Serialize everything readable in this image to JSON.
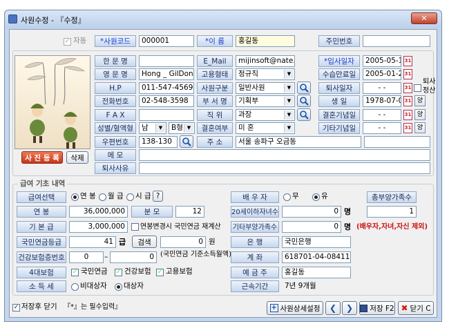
{
  "window": {
    "title": "사원수정 - 『수정』"
  },
  "top": {
    "auto_label": "자동",
    "emp_code_label": "*사원코드",
    "emp_code": "000001",
    "name_label": "*이 름",
    "name": "홍길동",
    "resident_label": "주민번호",
    "resident": ""
  },
  "personal": {
    "korean_name_label": "한 문 명",
    "korean_name": "",
    "english_name_label": "영 문 명",
    "english_name": "Hong _ GilDong",
    "hp_label": "H.P",
    "hp": "011-547-4569",
    "phone_label": "전화번호",
    "phone": "02-548-3598",
    "fax_label": "F A X",
    "fax": "",
    "gender_blood_label": "성별/혈액형",
    "gender": "남",
    "blood": "B형",
    "zip_label": "우편번호",
    "zip": "138-130",
    "email_label": "E_Mail",
    "email": "mijinsoft@nate.com",
    "employ_type_label": "고용형태",
    "employ_type": "정규직",
    "emp_class_label": "사원구분",
    "emp_class": "일반사원",
    "dept_label": "부 서 명",
    "dept": "기획부",
    "position_label": "직 위",
    "position": "과장",
    "marital_label": "결혼여부",
    "marital": "미 혼",
    "address_label": "주 소",
    "address": "서울 송파구 오금동",
    "memo_label": "메 모",
    "memo": "",
    "resign_reason_label": "퇴사사유",
    "resign_reason": "",
    "photo_register": "사 진 등 록",
    "photo_delete": "삭제"
  },
  "dates": {
    "join_label": "*입사일자",
    "join": "2005-05-15",
    "probation_label": "수습만료일",
    "probation": "2005-01-23",
    "retire_label": "퇴사일자",
    "retire": "- -",
    "birth_label": "생 일",
    "birth": "1978-07-07",
    "birth_lunar": "양",
    "wedding_label": "결혼기념일",
    "wedding": "- -",
    "wedding_lunar": "양",
    "other_label": "기타기념일",
    "other": "- -",
    "other_lunar": "양",
    "retire_side": "퇴사",
    "settle_side": "정산"
  },
  "salary": {
    "section_title": "급여 기초 내역",
    "pay_select_label": "급여선택",
    "opt_year": "연 봉",
    "opt_month": "월 급",
    "opt_hour": "시 급",
    "help": "?",
    "annual_label": "연 봉",
    "annual": "36,000,000",
    "denominator_label": "분 모",
    "denominator": "12",
    "base_label": "기 본 급",
    "base": "3,000,000",
    "pension_recalc": "연봉변경시 국민연금 재계산",
    "pension_grade_label": "국민연금등급",
    "pension_grade": "41",
    "grade_unit": "급",
    "search_btn": "검색",
    "pension_amount": "0",
    "won": "원",
    "pension_basis": "(국민연금 기준소득월액)",
    "health_no_label": "건강보험증번호",
    "health_no_a": "0",
    "health_no_b": "0",
    "ins4_label": "4대보험",
    "ins_pension": "국민연금",
    "ins_health": "건강보험",
    "ins_employment": "고용보험",
    "income_tax_label": "소 득 세",
    "tax_exempt": "비대상자",
    "tax_target": "대상자"
  },
  "family": {
    "spouse_label": "배 우 자",
    "spouse_no": "무",
    "spouse_yes": "유",
    "total_dependents_label": "총부양가족수",
    "total_dependents": "1",
    "under20_label": "20세이하자녀수",
    "under20": "0",
    "person_unit": "명",
    "other_dependents_label": "기타부양가족수",
    "other_dependents": "0",
    "exclude_note": "(배우자,자녀,자신 제외)",
    "bank_label": "은 행",
    "bank": "국민은행",
    "account_label": "계 좌",
    "account": "618701-04-084114",
    "holder_label": "예 금 주",
    "holder": "홍길동",
    "tenure_label": "근속기간",
    "tenure": "7년 9개월"
  },
  "footer": {
    "save_close": "저장후 닫기",
    "required_note": "『*』는 필수입력』",
    "detail_btn": "사원상세설정",
    "save_btn": "저장 F2",
    "close_btn": "닫기 C"
  },
  "colors": {
    "label_text": "#1a2a55",
    "required": "#1a3ccf",
    "warning": "#cc1111",
    "photo_btn": "#d43a1a"
  }
}
